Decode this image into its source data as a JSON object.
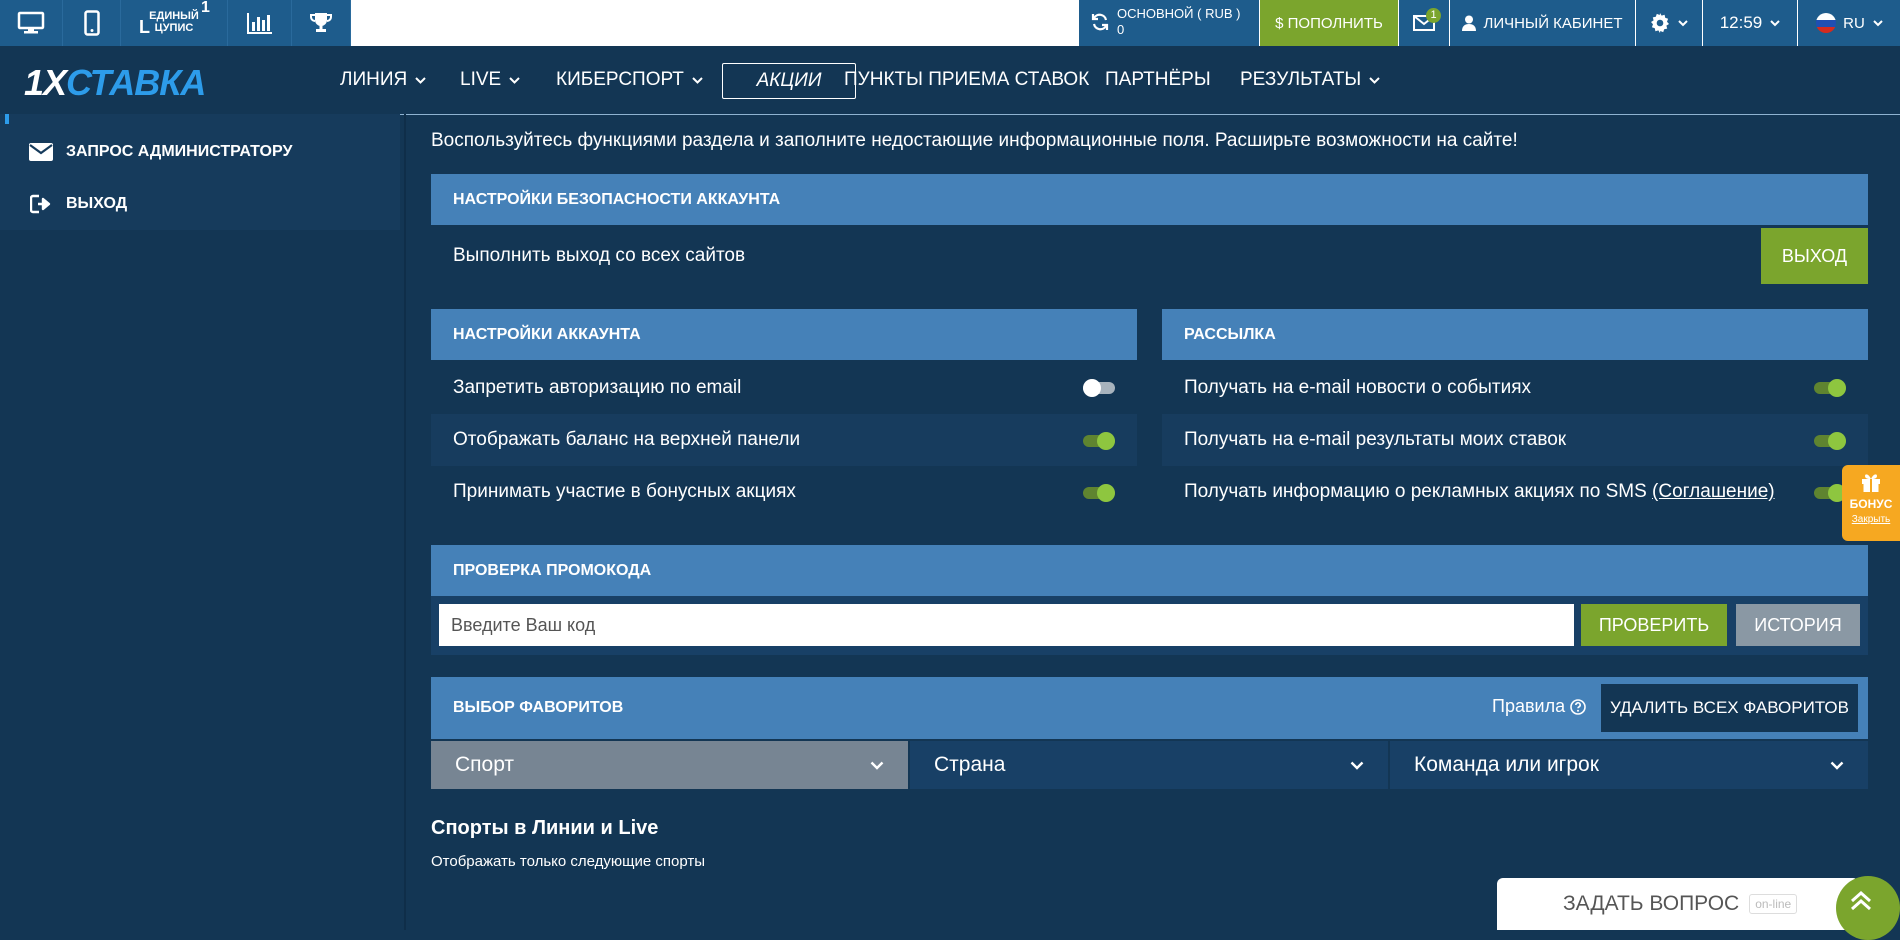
{
  "topbar": {
    "cupis_line1": "ЕДИНЫЙ",
    "cupis_line2": "ЦУПИС",
    "cupis_one": "1",
    "account_label": "ОСНОВНОЙ ( RUB )",
    "account_balance": "0",
    "deposit_label": "$ ПОПОЛНИТЬ",
    "mail_count": "1",
    "cabinet_label": "ЛИЧНЫЙ КАБИНЕТ",
    "time": "12:59",
    "lang": "RU"
  },
  "logo": {
    "part1": "1X",
    "part2": "СТАВКА"
  },
  "nav": {
    "line": "ЛИНИЯ",
    "live": "LIVE",
    "esports": "КИБЕРСПОРТ",
    "promos": "АКЦИИ",
    "points": "ПУНКТЫ ПРИЕМА СТАВОК",
    "partners": "ПАРТНЁРЫ",
    "results": "РЕЗУЛЬТАТЫ"
  },
  "sidebar": {
    "items": [
      {
        "label": "ЗАПРОС АДМИНИСТРАТОРУ",
        "icon": "envelope-icon"
      },
      {
        "label": "ВЫХОД",
        "icon": "logout-icon"
      }
    ]
  },
  "intro": "Воспользуйтесь функциями раздела и заполните недостающие информационные поля. Расширьте возможности на сайте!",
  "security": {
    "title": "НАСТРОЙКИ БЕЗОПАСНОСТИ АККАУНТА",
    "row_label": "Выполнить выход со всех сайтов",
    "button": "ВЫХОД"
  },
  "account_settings": {
    "title": "НАСТРОЙКИ АККАУНТА",
    "rows": [
      {
        "label": "Запретить авторизацию по email",
        "enabled": false
      },
      {
        "label": "Отображать баланс на верхней панели",
        "enabled": true
      },
      {
        "label": "Принимать участие в бонусных акциях",
        "enabled": true
      }
    ]
  },
  "mailing": {
    "title": "РАССЫЛКА",
    "rows": [
      {
        "label": "Получать на e-mail новости о событиях",
        "enabled": true
      },
      {
        "label": "Получать на e-mail результаты моих ставок",
        "enabled": true
      },
      {
        "label": "Получать информацию о рекламных акциях по SMS",
        "link": "(Соглашение)",
        "enabled": true
      }
    ]
  },
  "promo": {
    "title": "ПРОВЕРКА ПРОМОКОДА",
    "placeholder": "Введите Ваш код",
    "check_button": "ПРОВЕРИТЬ",
    "history_button": "ИСТОРИЯ"
  },
  "favorites": {
    "title": "ВЫБОР ФАВОРИТОВ",
    "rules": "Правила",
    "delete_button": "УДАЛИТЬ ВСЕХ ФАВОРИТОВ",
    "selects": [
      "Спорт",
      "Страна",
      "Команда или игрок"
    ]
  },
  "sports": {
    "title": "Спорты в Линии и Live",
    "subtitle": "Отображать только следующие спорты"
  },
  "bonus": {
    "label": "БОНУС",
    "close": "Закрыть"
  },
  "ask": {
    "label": "ЗАДАТЬ ВОПРОС",
    "status": "on-line"
  },
  "colors": {
    "bg": "#133654",
    "panel": "#4581b8",
    "green": "#7ba52d",
    "bonus": "#f6a821"
  }
}
